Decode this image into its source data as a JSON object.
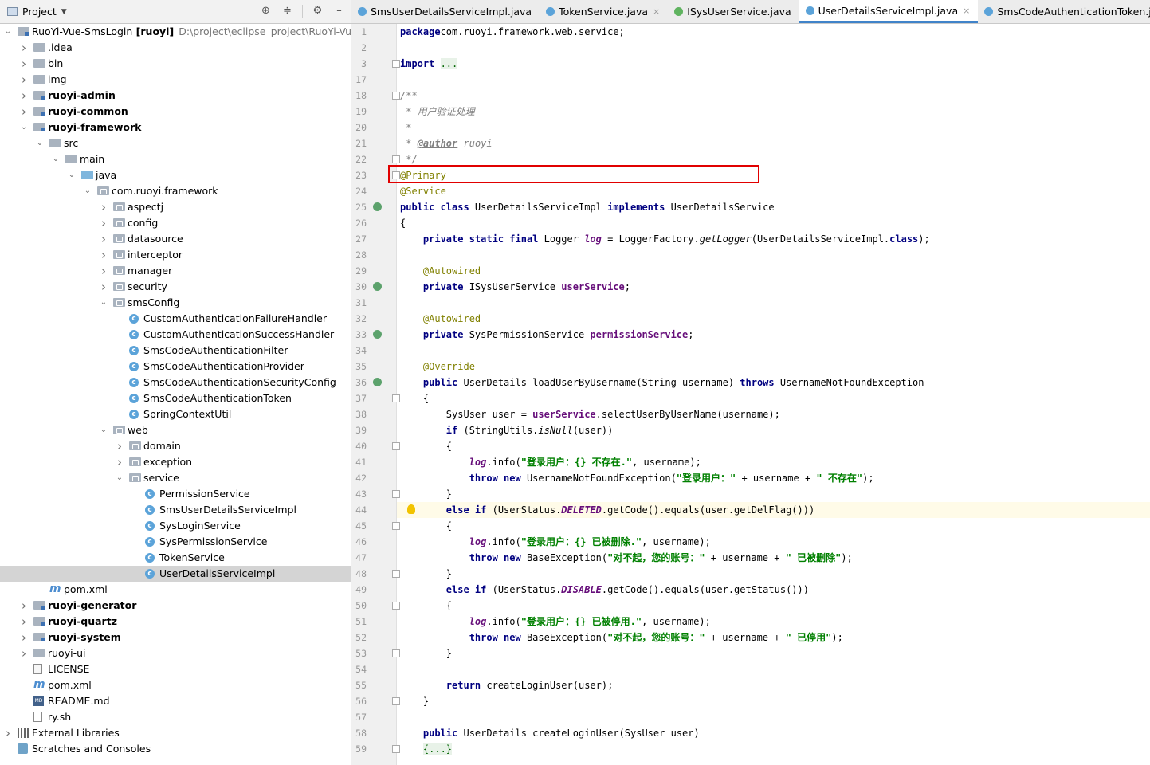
{
  "project_panel": {
    "title": "Project",
    "tree": [
      {
        "label": "RuoYi-Vue-SmsLogin",
        "suffix": " [ruoyi]",
        "path": "D:\\project\\eclipse_project\\RuoYi-Vue-Sm",
        "depth": 0,
        "arrow": "down",
        "icon": "folder-mod",
        "bold": false
      },
      {
        "label": ".idea",
        "depth": 1,
        "arrow": "right",
        "icon": "folder"
      },
      {
        "label": "bin",
        "depth": 1,
        "arrow": "right",
        "icon": "folder"
      },
      {
        "label": "img",
        "depth": 1,
        "arrow": "right",
        "icon": "folder"
      },
      {
        "label": "ruoyi-admin",
        "depth": 1,
        "arrow": "right",
        "icon": "folder-mod",
        "bold": true
      },
      {
        "label": "ruoyi-common",
        "depth": 1,
        "arrow": "right",
        "icon": "folder-mod",
        "bold": true
      },
      {
        "label": "ruoyi-framework",
        "depth": 1,
        "arrow": "down",
        "icon": "folder-mod",
        "bold": true
      },
      {
        "label": "src",
        "depth": 2,
        "arrow": "down",
        "icon": "folder"
      },
      {
        "label": "main",
        "depth": 3,
        "arrow": "down",
        "icon": "folder"
      },
      {
        "label": "java",
        "depth": 4,
        "arrow": "down",
        "icon": "folder-blue"
      },
      {
        "label": "com.ruoyi.framework",
        "depth": 5,
        "arrow": "down",
        "icon": "folder-pkg"
      },
      {
        "label": "aspectj",
        "depth": 6,
        "arrow": "right",
        "icon": "folder-pkg"
      },
      {
        "label": "config",
        "depth": 6,
        "arrow": "right",
        "icon": "folder-pkg"
      },
      {
        "label": "datasource",
        "depth": 6,
        "arrow": "right",
        "icon": "folder-pkg"
      },
      {
        "label": "interceptor",
        "depth": 6,
        "arrow": "right",
        "icon": "folder-pkg"
      },
      {
        "label": "manager",
        "depth": 6,
        "arrow": "right",
        "icon": "folder-pkg"
      },
      {
        "label": "security",
        "depth": 6,
        "arrow": "right",
        "icon": "folder-pkg"
      },
      {
        "label": "smsConfig",
        "depth": 6,
        "arrow": "down",
        "icon": "folder-pkg"
      },
      {
        "label": "CustomAuthenticationFailureHandler",
        "depth": 7,
        "icon": "class"
      },
      {
        "label": "CustomAuthenticationSuccessHandler",
        "depth": 7,
        "icon": "class"
      },
      {
        "label": "SmsCodeAuthenticationFilter",
        "depth": 7,
        "icon": "class"
      },
      {
        "label": "SmsCodeAuthenticationProvider",
        "depth": 7,
        "icon": "class"
      },
      {
        "label": "SmsCodeAuthenticationSecurityConfig",
        "depth": 7,
        "icon": "class"
      },
      {
        "label": "SmsCodeAuthenticationToken",
        "depth": 7,
        "icon": "class"
      },
      {
        "label": "SpringContextUtil",
        "depth": 7,
        "icon": "class"
      },
      {
        "label": "web",
        "depth": 6,
        "arrow": "down",
        "icon": "folder-pkg"
      },
      {
        "label": "domain",
        "depth": 7,
        "arrow": "right",
        "icon": "folder-pkg"
      },
      {
        "label": "exception",
        "depth": 7,
        "arrow": "right",
        "icon": "folder-pkg"
      },
      {
        "label": "service",
        "depth": 7,
        "arrow": "down",
        "icon": "folder-pkg"
      },
      {
        "label": "PermissionService",
        "depth": 8,
        "icon": "class"
      },
      {
        "label": "SmsUserDetailsServiceImpl",
        "depth": 8,
        "icon": "class"
      },
      {
        "label": "SysLoginService",
        "depth": 8,
        "icon": "class"
      },
      {
        "label": "SysPermissionService",
        "depth": 8,
        "icon": "class"
      },
      {
        "label": "TokenService",
        "depth": 8,
        "icon": "class"
      },
      {
        "label": "UserDetailsServiceImpl",
        "depth": 8,
        "icon": "class",
        "selected": true
      },
      {
        "label": "pom.xml",
        "depth": 2,
        "icon": "maven"
      },
      {
        "label": "ruoyi-generator",
        "depth": 1,
        "arrow": "right",
        "icon": "folder-mod",
        "bold": true
      },
      {
        "label": "ruoyi-quartz",
        "depth": 1,
        "arrow": "right",
        "icon": "folder-mod",
        "bold": true
      },
      {
        "label": "ruoyi-system",
        "depth": 1,
        "arrow": "right",
        "icon": "folder-mod",
        "bold": true
      },
      {
        "label": "ruoyi-ui",
        "depth": 1,
        "arrow": "right",
        "icon": "folder"
      },
      {
        "label": "LICENSE",
        "depth": 1,
        "icon": "text"
      },
      {
        "label": "pom.xml",
        "depth": 1,
        "icon": "maven"
      },
      {
        "label": "README.md",
        "depth": 1,
        "icon": "md"
      },
      {
        "label": "ry.sh",
        "depth": 1,
        "icon": "sh"
      },
      {
        "label": "External Libraries",
        "depth": 0,
        "arrow": "right",
        "icon": "lib"
      },
      {
        "label": "Scratches and Consoles",
        "depth": 0,
        "icon": "scratch"
      }
    ]
  },
  "editor": {
    "tabs": [
      {
        "label": "SmsUserDetailsServiceImpl.java",
        "icon": "class",
        "active": false,
        "closable": false
      },
      {
        "label": "TokenService.java",
        "icon": "class",
        "active": false,
        "closable": true
      },
      {
        "label": "ISysUserService.java",
        "icon": "interface",
        "active": false,
        "closable": false
      },
      {
        "label": "UserDetailsServiceImpl.java",
        "icon": "class",
        "active": true,
        "closable": true
      },
      {
        "label": "SmsCodeAuthenticationToken.java",
        "icon": "class",
        "active": false,
        "closable": false
      }
    ],
    "lines": [
      {
        "n": "1",
        "t": [
          [
            "kw",
            "package"
          ],
          [
            "",
            "com.ruoyi.framework.web.service;"
          ]
        ]
      },
      {
        "n": "2",
        "t": []
      },
      {
        "n": "3",
        "t": [
          [
            "kw",
            "import "
          ],
          [
            "gr",
            "..."
          ]
        ],
        "fold": true
      },
      {
        "n": "17",
        "t": []
      },
      {
        "n": "18",
        "t": [
          [
            "cm",
            "/**"
          ]
        ],
        "fold": true
      },
      {
        "n": "19",
        "t": [
          [
            "cm",
            " * 用户验证处理"
          ]
        ]
      },
      {
        "n": "20",
        "t": [
          [
            "cm",
            " *"
          ]
        ]
      },
      {
        "n": "21",
        "t": [
          [
            "cm",
            " * "
          ],
          [
            "cmb",
            "@author"
          ],
          [
            "cm",
            " ruoyi"
          ]
        ]
      },
      {
        "n": "22",
        "t": [
          [
            "cm",
            " */"
          ]
        ],
        "fold": true
      },
      {
        "n": "23",
        "t": [
          [
            "an",
            "@Primary"
          ]
        ],
        "fold": true
      },
      {
        "n": "24",
        "t": [
          [
            "an",
            "@Service"
          ]
        ]
      },
      {
        "n": "25",
        "t": [
          [
            "kw",
            "public class "
          ],
          [
            "",
            "UserDetailsServiceImpl "
          ],
          [
            "kw",
            "implements "
          ],
          [
            "",
            "UserDetailsService"
          ]
        ],
        "gicon": true
      },
      {
        "n": "26",
        "t": [
          [
            "",
            "{"
          ]
        ]
      },
      {
        "n": "27",
        "t": [
          [
            "",
            "    "
          ],
          [
            "kw",
            "private static final "
          ],
          [
            "",
            "Logger "
          ],
          [
            "sfi",
            "log"
          ],
          [
            "",
            " = LoggerFactory."
          ],
          [
            "it",
            "getLogger"
          ],
          [
            "",
            "(UserDetailsServiceImpl."
          ],
          [
            "kw",
            "class"
          ],
          [
            "",
            ");"
          ]
        ]
      },
      {
        "n": "28",
        "t": []
      },
      {
        "n": "29",
        "t": [
          [
            "",
            "    "
          ],
          [
            "an",
            "@Autowired"
          ]
        ]
      },
      {
        "n": "30",
        "t": [
          [
            "",
            "    "
          ],
          [
            "kw",
            "private "
          ],
          [
            "",
            "ISysUserService "
          ],
          [
            "fl",
            "userService"
          ],
          [
            "",
            ";"
          ]
        ],
        "gicon": true
      },
      {
        "n": "31",
        "t": []
      },
      {
        "n": "32",
        "t": [
          [
            "",
            "    "
          ],
          [
            "an",
            "@Autowired"
          ]
        ]
      },
      {
        "n": "33",
        "t": [
          [
            "",
            "    "
          ],
          [
            "kw",
            "private "
          ],
          [
            "",
            "SysPermissionService "
          ],
          [
            "fl",
            "permissionService"
          ],
          [
            "",
            ";"
          ]
        ],
        "gicon": true
      },
      {
        "n": "34",
        "t": []
      },
      {
        "n": "35",
        "t": [
          [
            "",
            "    "
          ],
          [
            "an",
            "@Override"
          ]
        ]
      },
      {
        "n": "36",
        "t": [
          [
            "",
            "    "
          ],
          [
            "kw",
            "public "
          ],
          [
            "",
            "UserDetails loadUserByUsername(String username) "
          ],
          [
            "kw",
            "throws "
          ],
          [
            "",
            "UsernameNotFoundException"
          ]
        ],
        "gicon": true
      },
      {
        "n": "37",
        "t": [
          [
            "",
            "    {"
          ]
        ],
        "fold": true
      },
      {
        "n": "38",
        "t": [
          [
            "",
            "        SysUser user = "
          ],
          [
            "fl",
            "userService"
          ],
          [
            "",
            ".selectUserByUserName(username);"
          ]
        ]
      },
      {
        "n": "39",
        "t": [
          [
            "",
            "        "
          ],
          [
            "kw",
            "if "
          ],
          [
            "",
            "(StringUtils."
          ],
          [
            "it",
            "isNull"
          ],
          [
            "",
            "(user))"
          ]
        ]
      },
      {
        "n": "40",
        "t": [
          [
            "",
            "        {"
          ]
        ],
        "fold": true
      },
      {
        "n": "41",
        "t": [
          [
            "",
            "            "
          ],
          [
            "sfi",
            "log"
          ],
          [
            "",
            ".info("
          ],
          [
            "st",
            "\"登录用户：{} 不存在.\""
          ],
          [
            "",
            ", username);"
          ]
        ]
      },
      {
        "n": "42",
        "t": [
          [
            "",
            "            "
          ],
          [
            "kw",
            "throw new "
          ],
          [
            "",
            "UsernameNotFoundException("
          ],
          [
            "st",
            "\"登录用户：\""
          ],
          [
            "",
            " + username + "
          ],
          [
            "st",
            "\" 不存在\""
          ],
          [
            "",
            ");"
          ]
        ]
      },
      {
        "n": "43",
        "t": [
          [
            "",
            "        }"
          ]
        ],
        "fold": true
      },
      {
        "n": "44",
        "t": [
          [
            "",
            "        "
          ],
          [
            "kw",
            "else if "
          ],
          [
            "",
            "(UserStatus."
          ],
          [
            "sfi",
            "DELETED"
          ],
          [
            "",
            ".getCode().equals(user.getDelFlag()))"
          ]
        ],
        "hl": true,
        "bulb": true
      },
      {
        "n": "45",
        "t": [
          [
            "",
            "        {"
          ]
        ],
        "fold": true
      },
      {
        "n": "46",
        "t": [
          [
            "",
            "            "
          ],
          [
            "sfi",
            "log"
          ],
          [
            "",
            ".info("
          ],
          [
            "st",
            "\"登录用户：{} 已被删除.\""
          ],
          [
            "",
            ", username);"
          ]
        ]
      },
      {
        "n": "47",
        "t": [
          [
            "",
            "            "
          ],
          [
            "kw",
            "throw new "
          ],
          [
            "",
            "BaseException("
          ],
          [
            "st",
            "\"对不起，您的账号：\""
          ],
          [
            "",
            " + username + "
          ],
          [
            "st",
            "\" 已被删除\""
          ],
          [
            "",
            ");"
          ]
        ]
      },
      {
        "n": "48",
        "t": [
          [
            "",
            "        }"
          ]
        ],
        "fold": true
      },
      {
        "n": "49",
        "t": [
          [
            "",
            "        "
          ],
          [
            "kw",
            "else if "
          ],
          [
            "",
            "(UserStatus."
          ],
          [
            "sfi",
            "DISABLE"
          ],
          [
            "",
            ".getCode().equals(user.getStatus()))"
          ]
        ]
      },
      {
        "n": "50",
        "t": [
          [
            "",
            "        {"
          ]
        ],
        "fold": true
      },
      {
        "n": "51",
        "t": [
          [
            "",
            "            "
          ],
          [
            "sfi",
            "log"
          ],
          [
            "",
            ".info("
          ],
          [
            "st",
            "\"登录用户：{} 已被停用.\""
          ],
          [
            "",
            ", username);"
          ]
        ]
      },
      {
        "n": "52",
        "t": [
          [
            "",
            "            "
          ],
          [
            "kw",
            "throw new "
          ],
          [
            "",
            "BaseException("
          ],
          [
            "st",
            "\"对不起，您的账号：\""
          ],
          [
            "",
            " + username + "
          ],
          [
            "st",
            "\" 已停用\""
          ],
          [
            "",
            ");"
          ]
        ]
      },
      {
        "n": "53",
        "t": [
          [
            "",
            "        }"
          ]
        ],
        "fold": true
      },
      {
        "n": "54",
        "t": []
      },
      {
        "n": "55",
        "t": [
          [
            "",
            "        "
          ],
          [
            "kw",
            "return "
          ],
          [
            "",
            "createLoginUser(user);"
          ]
        ]
      },
      {
        "n": "56",
        "t": [
          [
            "",
            "    }"
          ]
        ],
        "fold": true
      },
      {
        "n": "57",
        "t": []
      },
      {
        "n": "58",
        "t": [
          [
            "",
            "    "
          ],
          [
            "kw",
            "public "
          ],
          [
            "",
            "UserDetails createLoginUser(SysUser user)"
          ]
        ]
      },
      {
        "n": "59",
        "t": [
          [
            "",
            "    "
          ],
          [
            "gr",
            "{...}"
          ]
        ],
        "fold": true
      }
    ]
  }
}
